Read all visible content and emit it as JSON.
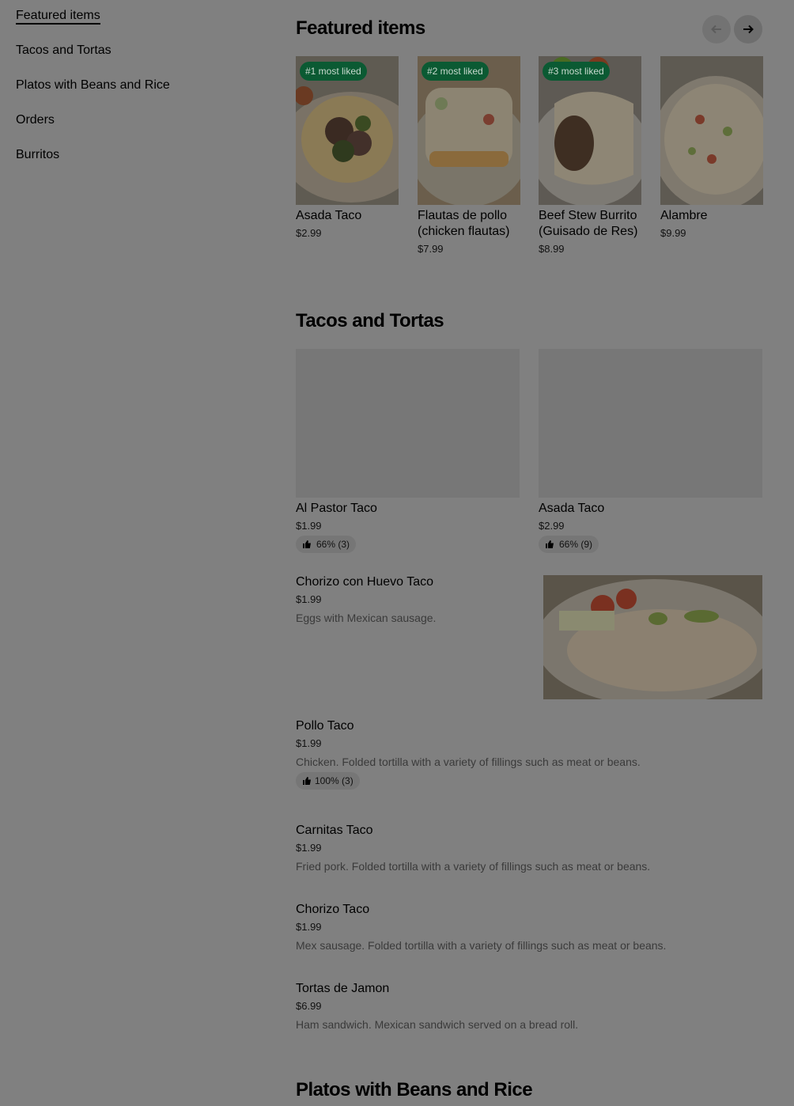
{
  "sidebar": {
    "items": [
      {
        "label": "Featured items"
      },
      {
        "label": "Tacos and Tortas"
      },
      {
        "label": "Platos with Beans and Rice"
      },
      {
        "label": "Orders"
      },
      {
        "label": "Burritos"
      }
    ]
  },
  "featured": {
    "title": "Featured items",
    "items": [
      {
        "badge": "#1 most liked",
        "name": "Asada Taco",
        "price": "$2.99"
      },
      {
        "badge": "#2 most liked",
        "name": "Flautas de pollo (chicken flautas)",
        "price": "$7.99"
      },
      {
        "badge": "#3 most liked",
        "name": "Beef Stew Burrito (Guisado de Res)",
        "price": "$8.99"
      },
      {
        "badge": "",
        "name": "Alambre",
        "price": "$9.99"
      }
    ]
  },
  "tacos": {
    "title": "Tacos and Tortas",
    "cards": [
      {
        "name": "Al Pastor Taco",
        "price": "$1.99",
        "rating": "66% (3)"
      },
      {
        "name": "Asada Taco",
        "price": "$2.99",
        "rating": "66% (9)"
      }
    ],
    "list": [
      {
        "name": "Chorizo con Huevo Taco",
        "price": "$1.99",
        "desc": "Eggs with Mexican sausage."
      },
      {
        "name": "Pollo Taco",
        "price": "$1.99",
        "desc": "Chicken. Folded tortilla with a variety of fillings such as meat or beans.",
        "rating": "100% (3)"
      },
      {
        "name": "Carnitas Taco",
        "price": "$1.99",
        "desc": "Fried pork. Folded tortilla with a variety of fillings such as meat or beans."
      },
      {
        "name": "Chorizo Taco",
        "price": "$1.99",
        "desc": "Mex sausage. Folded tortilla with a variety of fillings such as meat or beans."
      },
      {
        "name": "Tortas de Jamon",
        "price": "$6.99",
        "desc": "Ham sandwich. Mexican sandwich served on a bread roll."
      }
    ]
  },
  "platos": {
    "title": "Platos with Beans and Rice"
  },
  "icons": {
    "prev": "arrow-left-icon",
    "next": "arrow-right-icon",
    "thumb": "thumbs-up-icon"
  },
  "colors": {
    "badge_bg": "#0b5a33",
    "overlay": "#808080"
  }
}
